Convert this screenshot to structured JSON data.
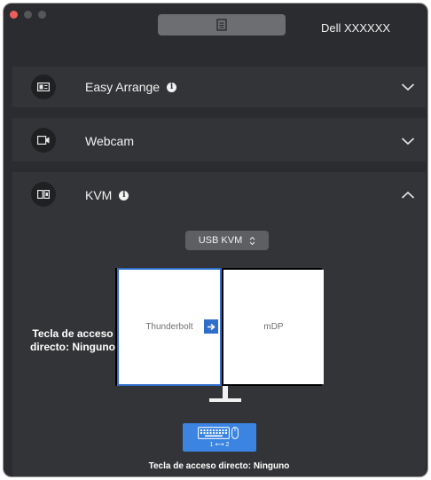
{
  "window": {
    "monitor_name": "Dell XXXXXX"
  },
  "sections": [
    {
      "title": "Easy Arrange",
      "expanded": false,
      "has_info": true
    },
    {
      "title": "Webcam",
      "expanded": false,
      "has_info": false
    },
    {
      "title": "KVM",
      "expanded": true,
      "has_info": true
    }
  ],
  "kvm": {
    "mode_select": "USB KVM",
    "left_input": "Thunderbolt",
    "right_input": "mDP",
    "hotkey_left": "Tecla de acceso directo: Ninguno",
    "switch_label": "1 ⟷ 2",
    "hotkey_bottom": "Tecla de acceso directo: Ninguno"
  },
  "colors": {
    "accent": "#3b84e2",
    "selected_border": "#2f6fcb",
    "close_button": "#ed5f58"
  },
  "icons": {
    "menu": "document-list-icon",
    "easy_arrange": "layout-icon",
    "webcam": "webcam-icon",
    "kvm": "kvm-icon",
    "info": "info-icon",
    "collapse": "chevron-down-icon",
    "expand": "chevron-up-icon",
    "switch_arrow": "arrow-right-icon",
    "keyboard": "keyboard-icon",
    "mouse": "mouse-icon"
  }
}
